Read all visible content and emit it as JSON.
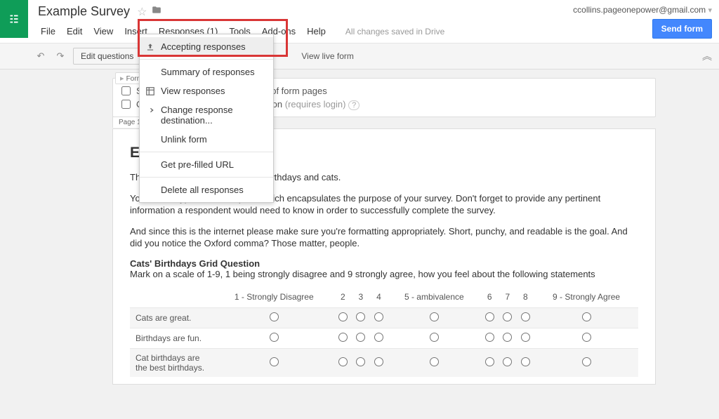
{
  "header": {
    "doc_title": "Example Survey",
    "user_email": "ccollins.pageonepower@gmail.com",
    "send_button": "Send form",
    "menu": [
      "File",
      "Edit",
      "View",
      "Insert",
      "Responses (1)",
      "Tools",
      "Add-ons",
      "Help"
    ],
    "saved": "All changes saved in Drive"
  },
  "toolbar": {
    "edit_questions": "Edit questions",
    "view_live": "View live form"
  },
  "dropdown": {
    "accepting": "Accepting responses",
    "summary": "Summary of responses",
    "view": "View responses",
    "change_dest": "Change response destination...",
    "unlink": "Unlink form",
    "prefill": "Get pre-filled URL",
    "delete_all": "Delete all responses"
  },
  "form_settings": {
    "label": "Form Settings",
    "progress": "Show progress bar at the bottom of form pages",
    "one_response": "Only allow one response per person",
    "requires_login": "(requires login)"
  },
  "page": {
    "tab": "Page 1 of 1",
    "title": "Example Survey",
    "desc1": "This is an example survey, full of birthdays and cats.",
    "desc2": "You should type in a description which encapsulates the purpose of your survey. Don't forget to provide any pertinent information a respondent would need to know in order to successfully complete the survey.",
    "desc3": "And since this is the internet please make sure you're formatting appropriately. Short, punchy, and readable is the goal. And did you notice the Oxford comma? Those matter, people.",
    "question_title": "Cats' Birthdays Grid Question",
    "question_sub": "Mark on a scale of 1-9, 1 being strongly disagree and 9 strongly agree, how you feel about the following statements",
    "columns": [
      "1 - Strongly Disagree",
      "2",
      "3",
      "4",
      "5 - ambivalence",
      "6",
      "7",
      "8",
      "9 - Strongly Agree"
    ],
    "rows": [
      "Cats are great.",
      "Birthdays are fun.",
      "Cat birthdays are the best birthdays."
    ]
  }
}
